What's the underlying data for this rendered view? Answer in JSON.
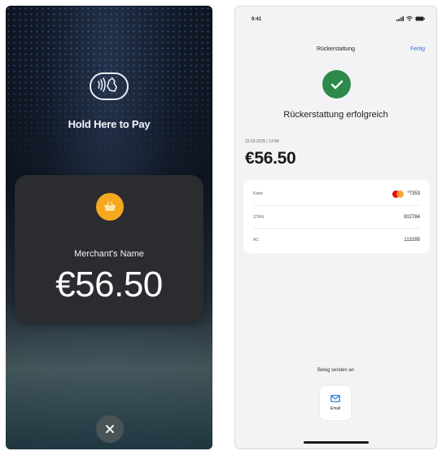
{
  "left_screen": {
    "prompt": "Hold Here to Pay",
    "merchant_name": "Merchant's Name",
    "amount": "€56.50",
    "contactless_icon": "contactless-payment-icon",
    "merchant_logo_icon": "basket-icon",
    "merchant_logo_color": "#f5a81f",
    "close_icon": "close-icon"
  },
  "right_screen": {
    "status_time": "9:41",
    "nav_title": "Rückerstattung",
    "nav_done": "Fertig",
    "success_message": "Rückerstattung erfolgreich",
    "success_color": "#2e8a4a",
    "date_time": "22.03.2025  |  13:58",
    "amount": "€56.50",
    "details": [
      {
        "label": "Karte",
        "value": "*7353",
        "icon": "mastercard-icon"
      },
      {
        "label": "STAN",
        "value": "002784"
      },
      {
        "label": "AC",
        "value": "113295"
      }
    ],
    "send_label": "Beleg senden an",
    "email_button": {
      "label": "Email",
      "icon": "mail-icon"
    },
    "accent_color": "#2b6fd6"
  }
}
